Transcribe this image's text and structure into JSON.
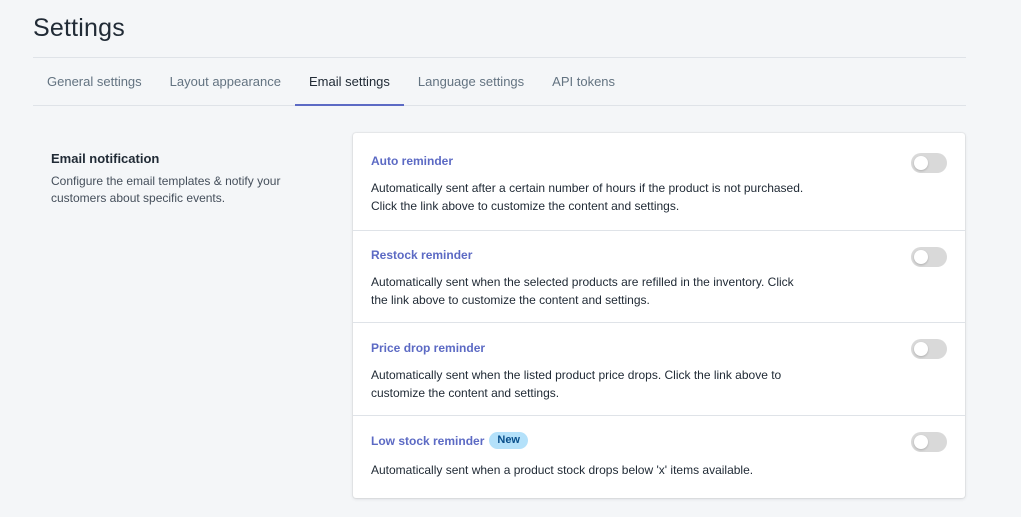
{
  "page": {
    "title": "Settings"
  },
  "tabs": [
    {
      "label": "General settings",
      "active": false
    },
    {
      "label": "Layout appearance",
      "active": false
    },
    {
      "label": "Email settings",
      "active": true
    },
    {
      "label": "Language settings",
      "active": false
    },
    {
      "label": "API tokens",
      "active": false
    }
  ],
  "section": {
    "heading": "Email notification",
    "description": "Configure the email templates & notify your customers about specific events."
  },
  "reminders": [
    {
      "title": "Auto reminder",
      "badge": "",
      "description": "Automatically sent after a certain number of hours if the product is not purchased. Click the link above to customize the content and settings.",
      "enabled": false
    },
    {
      "title": "Restock reminder",
      "badge": "",
      "description": "Automatically sent when the selected products are refilled in the inventory. Click the link above to customize the content and settings.",
      "enabled": false
    },
    {
      "title": "Price drop reminder",
      "badge": "",
      "description": "Automatically sent when the listed product price drops. Click the link above to customize the content and settings.",
      "enabled": false
    },
    {
      "title": "Low stock reminder",
      "badge": "New",
      "description": "Automatically sent when a product stock drops below 'x' items available.",
      "enabled": false
    }
  ],
  "colors": {
    "accent": "#5c6ac4",
    "badge_bg": "#b4e1fa",
    "toggle_off": "#d9d9d9",
    "background": "#f4f6f8"
  }
}
